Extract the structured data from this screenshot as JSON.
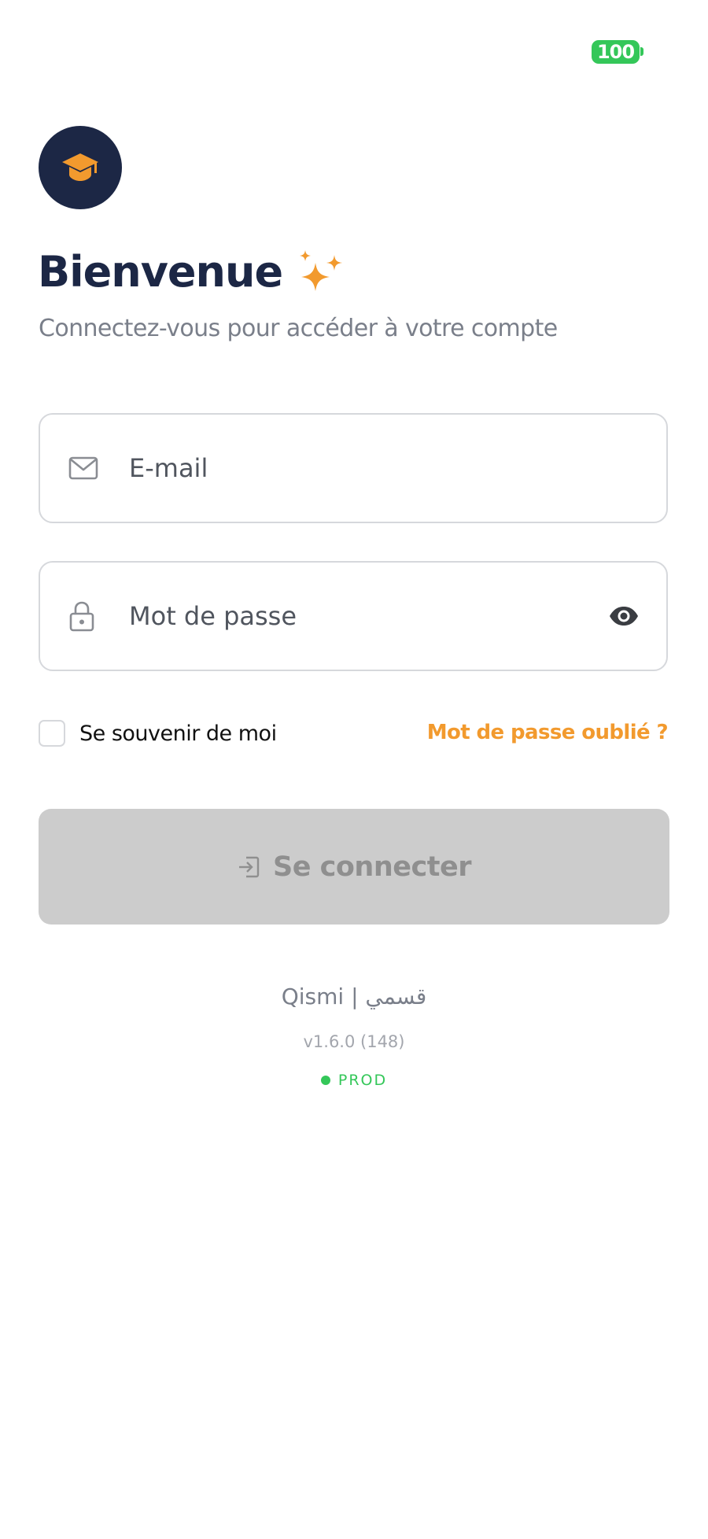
{
  "status_bar": {
    "battery_level": "100",
    "battery_color": "#34c759"
  },
  "header": {
    "logo_icon": "graduation-cap-icon",
    "title": "Bienvenue",
    "title_icon": "sparkles-icon",
    "subtitle": "Connectez-vous pour accéder à votre compte"
  },
  "form": {
    "email": {
      "icon": "mail-icon",
      "value": "",
      "placeholder": "E-mail"
    },
    "password": {
      "icon": "lock-icon",
      "value": "",
      "placeholder": "Mot de passe",
      "toggle_icon": "eye-icon"
    },
    "remember_me": {
      "label": "Se souvenir de moi",
      "checked": false
    },
    "forgot_password_label": "Mot de passe oublié ?",
    "submit": {
      "icon": "login-icon",
      "label": "Se connecter",
      "disabled": true
    }
  },
  "footer": {
    "brand": "Qismi | قسمي",
    "version": "v1.6.0 (148)",
    "environment": "PROD",
    "environment_color": "#34c759"
  },
  "colors": {
    "navy": "#1c2745",
    "accent_orange": "#f29a2e",
    "disabled_button": "#cccccc"
  }
}
